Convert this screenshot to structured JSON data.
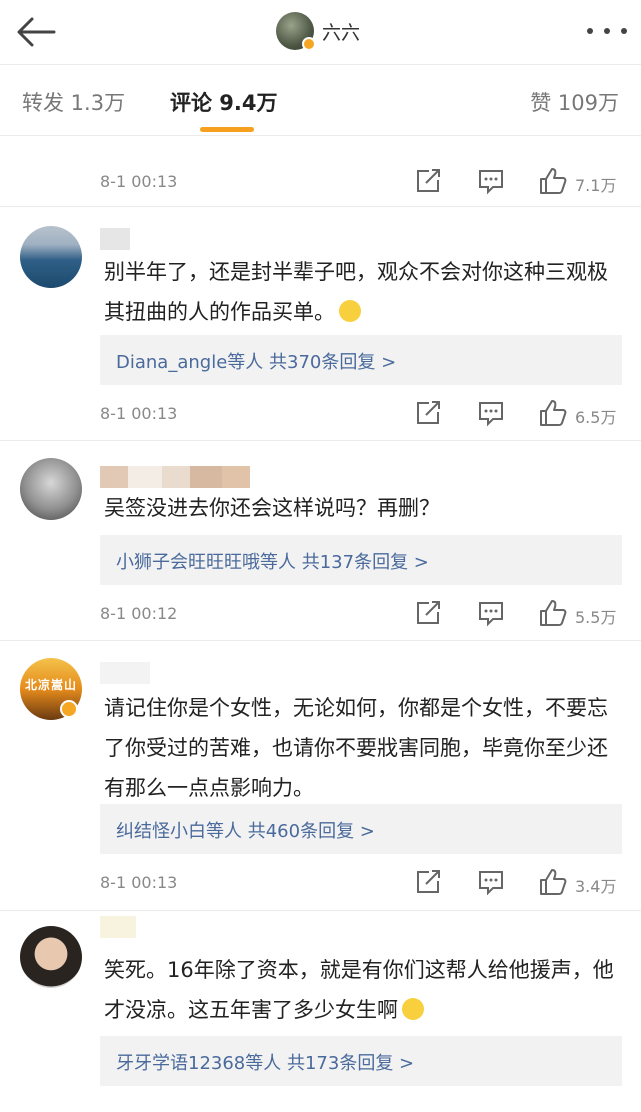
{
  "header": {
    "title": "六六",
    "back_icon": "arrow-left-icon",
    "more_icon": "more-dots-icon",
    "accent": "#f7a020"
  },
  "tabs": {
    "repost": "转发 1.3万",
    "comment": "评论 9.4万",
    "like": "赞 109万"
  },
  "comments": [
    {
      "time": "8-1 00:13",
      "likes": "7.1万"
    },
    {
      "text": "别半年了，还是封半辈子吧，观众不会对你这种三观极其扭曲的人的作品买单。",
      "replies": "Diana_angle等人  共370条回复 >",
      "time": "8-1 00:13",
      "likes": "6.5万"
    },
    {
      "text": "吴签没进去你还会这样说吗？再删？",
      "replies": "小狮子会旺旺旺哦等人  共137条回复 >",
      "time": "8-1 00:12",
      "likes": "5.5万"
    },
    {
      "avatar_caption": "北凉嵩山",
      "text": "请记住你是个女性，无论如何，你都是个女性，不要忘了你受过的苦难，也请你不要戕害同胞，毕竟你至少还有那么一点点影响力。",
      "replies": "纠结怪小白等人  共460条回复 >",
      "time": "8-1 00:13",
      "likes": "3.4万"
    },
    {
      "text": "笑死。16年除了资本，就是有你们这帮人给他援声，他才没凉。这五年害了多少女生啊",
      "replies": "牙牙学语12368等人  共173条回复 >"
    }
  ]
}
